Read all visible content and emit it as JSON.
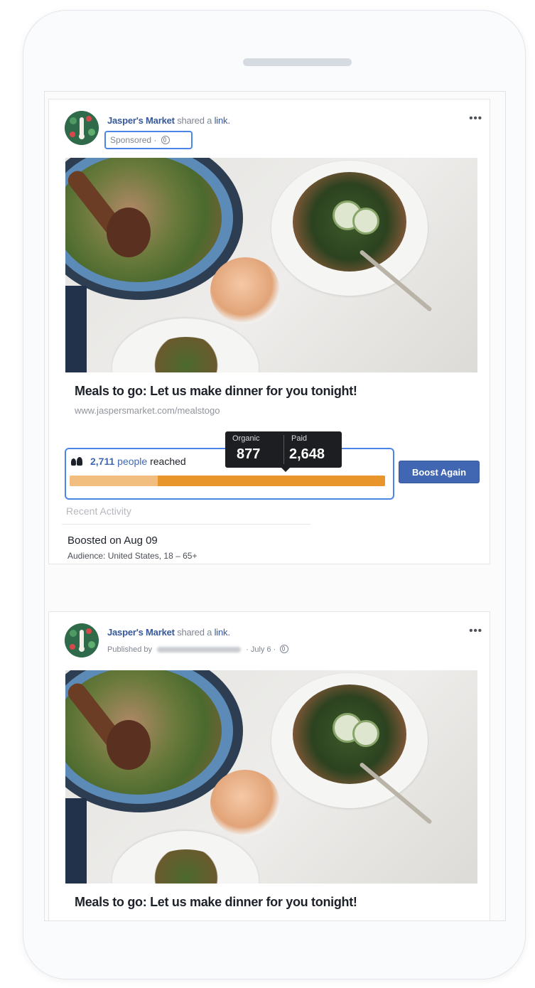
{
  "post1": {
    "page_name": "Jasper's Market",
    "shared_text": "shared a",
    "link_word": "link.",
    "sponsored": "Sponsored",
    "separator": "·",
    "more": "•••",
    "link_title": "Meals to go: Let us make dinner for you tonight!",
    "link_url": "www.jaspersmarket.com/mealstogo",
    "reach": {
      "count": "2,711",
      "people_word": "people",
      "reached_word": "reached",
      "organic_label": "Organic",
      "organic_value": "877",
      "paid_label": "Paid",
      "paid_value": "2,648",
      "organic_fraction": 0.28
    },
    "boost_button": "Boost Again",
    "recent_activity_label": "Recent Activity",
    "activity_title": "Boosted on Aug 09",
    "activity_audience": "Audience: United States, 18 – 65+"
  },
  "post2": {
    "page_name": "Jasper's Market",
    "shared_text": "shared a",
    "link_word": "link.",
    "published_by": "Published by",
    "date": "July 6",
    "separator": "·",
    "more": "•••",
    "link_title": "Meals to go: Let us make dinner for you tonight!"
  },
  "colors": {
    "accent_blue": "#4267b2",
    "highlight_border": "#4b86e6",
    "organic_bar": "#f2be80",
    "paid_bar": "#e8962b"
  },
  "icons": {
    "people": "people-icon",
    "globe": "globe-icon",
    "more": "more-icon"
  }
}
